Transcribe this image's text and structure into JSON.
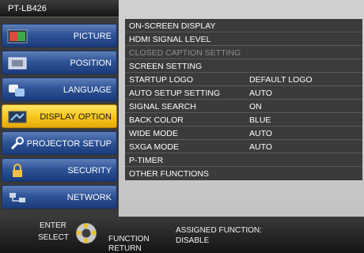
{
  "app": {
    "model": "PT-LB426"
  },
  "sidebar": {
    "items": [
      {
        "label": "PICTURE",
        "icon": "picture-icon",
        "active": false
      },
      {
        "label": "POSITION",
        "icon": "position-icon",
        "active": false
      },
      {
        "label": "LANGUAGE",
        "icon": "language-icon",
        "active": false
      },
      {
        "label": "DISPLAY OPTION",
        "icon": "display-option-icon",
        "active": true
      },
      {
        "label": "PROJECTOR SETUP",
        "icon": "projector-setup-icon",
        "active": false
      },
      {
        "label": "SECURITY",
        "icon": "lock-icon",
        "active": false
      },
      {
        "label": "NETWORK",
        "icon": "network-icon",
        "active": false
      }
    ]
  },
  "menu": {
    "rows": [
      {
        "label": "ON-SCREEN DISPLAY",
        "value": ""
      },
      {
        "label": "HDMI SIGNAL LEVEL",
        "value": ""
      },
      {
        "label": "CLOSED CAPTION SETTING",
        "value": "",
        "disabled": true
      },
      {
        "label": "SCREEN SETTING",
        "value": ""
      },
      {
        "label": "STARTUP LOGO",
        "value": "DEFAULT LOGO"
      },
      {
        "label": "AUTO SETUP SETTING",
        "value": "AUTO"
      },
      {
        "label": "SIGNAL SEARCH",
        "value": "ON"
      },
      {
        "label": "BACK COLOR",
        "value": "BLUE"
      },
      {
        "label": "WIDE MODE",
        "value": "AUTO"
      },
      {
        "label": "SXGA MODE",
        "value": "AUTO"
      },
      {
        "label": "P-TIMER",
        "value": ""
      },
      {
        "label": "OTHER FUNCTIONS",
        "value": ""
      }
    ]
  },
  "footer": {
    "enter": "ENTER",
    "select": "SELECT",
    "function": "FUNCTION",
    "return": "RETURN",
    "assigned_label": "ASSIGNED FUNCTION:",
    "assigned_value": "DISABLE"
  },
  "colors": {
    "sidebar_blue": "#2f5498",
    "active_yellow": "#f7c81c",
    "menu_bg": "#3b3b3b"
  }
}
